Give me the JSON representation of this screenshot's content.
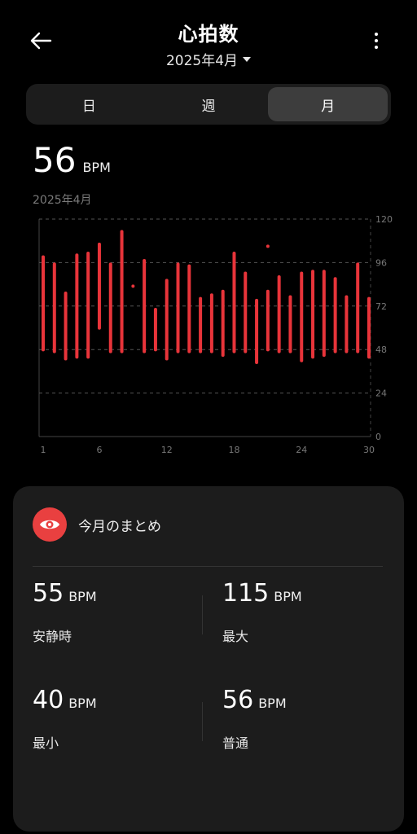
{
  "header": {
    "title": "心拍数",
    "month": "2025年4月"
  },
  "tabs": [
    {
      "label": "日",
      "active": false
    },
    {
      "label": "週",
      "active": false
    },
    {
      "label": "月",
      "active": true
    }
  ],
  "summary_value": {
    "value": "56",
    "unit": "BPM",
    "period": "2025年4月"
  },
  "chart_data": {
    "type": "bar",
    "x": [
      1,
      2,
      3,
      4,
      5,
      6,
      7,
      8,
      9,
      10,
      11,
      12,
      13,
      14,
      15,
      16,
      17,
      18,
      19,
      20,
      21,
      22,
      23,
      24,
      25,
      26,
      27,
      28,
      29,
      30
    ],
    "low": [
      47,
      46,
      42,
      43,
      43,
      59,
      46,
      46,
      null,
      46,
      47,
      42,
      46,
      46,
      46,
      46,
      44,
      46,
      46,
      40,
      47,
      46,
      46,
      41,
      43,
      44,
      46,
      46,
      46,
      43
    ],
    "high": [
      100,
      96,
      80,
      101,
      102,
      107,
      96,
      114,
      null,
      98,
      71,
      87,
      96,
      95,
      77,
      79,
      81,
      102,
      91,
      76,
      81,
      89,
      78,
      91,
      92,
      92,
      88,
      78,
      96,
      77
    ],
    "single_points": [
      {
        "x": 9,
        "y": 83
      },
      {
        "x": 21,
        "y": 105
      }
    ],
    "xticks": [
      "1",
      "6",
      "12",
      "18",
      "24",
      "30"
    ],
    "yticks": [
      "0",
      "24",
      "48",
      "72",
      "96",
      "120"
    ],
    "ylim": [
      0,
      120
    ],
    "bar_color": "#e8343a"
  },
  "card": {
    "title": "今月のまとめ",
    "icon": "eye-icon",
    "accent": "#e94040",
    "stats": [
      {
        "value": "55",
        "unit": "BPM",
        "label": "安静時"
      },
      {
        "value": "115",
        "unit": "BPM",
        "label": "最大"
      },
      {
        "value": "40",
        "unit": "BPM",
        "label": "最小"
      },
      {
        "value": "56",
        "unit": "BPM",
        "label": "普通"
      }
    ]
  }
}
